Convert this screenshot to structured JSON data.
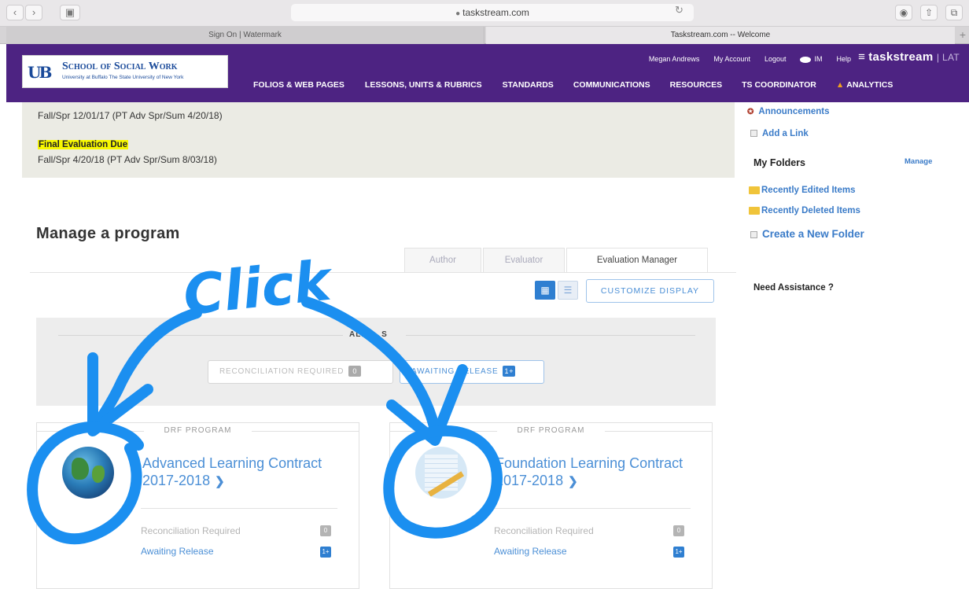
{
  "browser": {
    "address": "taskstream.com",
    "tabs": [
      "Sign On | Watermark",
      "Taskstream.com -- Welcome"
    ]
  },
  "header": {
    "logo_title": "School of Social Work",
    "logo_subtitle": "University at Buffalo The State University of New York",
    "utility": {
      "user": "Megan Andrews",
      "my_account": "My Account",
      "logout": "Logout",
      "im": "IM",
      "help": "Help"
    },
    "brand": "taskstream",
    "brand_suffix": "| LAT",
    "nav": [
      "FOLIOS & WEB PAGES",
      "LESSONS, UNITS & RUBRICS",
      "STANDARDS",
      "COMMUNICATIONS",
      "RESOURCES",
      "TS COORDINATOR",
      "ANALYTICS"
    ]
  },
  "due_dates": {
    "line1": "Fall/Spr 12/01/17 (PT Adv Spr/Sum 4/20/18)",
    "heading2": "Final Evaluation Due",
    "line2": "Fall/Spr 4/20/18 (PT Adv Spr/Sum 8/03/18)"
  },
  "manage": {
    "title": "Manage a program",
    "tabs": [
      "Author",
      "Evaluator",
      "Evaluation Manager"
    ],
    "active_tab": "Evaluation Manager",
    "customize_label": "CUSTOMIZE DISPLAY",
    "filter_label": "ALL ... S",
    "chips": [
      {
        "label": "RECONCILIATION REQUIRED",
        "count": "0"
      },
      {
        "label": "AWAITING RELEASE",
        "count": "1+"
      }
    ]
  },
  "programs": [
    {
      "type": "DRF PROGRAM",
      "title": "Advanced Learning Contract 2017-2018",
      "icon": "globe-icon",
      "stats": [
        {
          "label": "Reconciliation Required",
          "count": "0"
        },
        {
          "label": "Awaiting Release",
          "count": "1+"
        }
      ]
    },
    {
      "type": "DRF PROGRAM",
      "title": "Foundation Learning Contract 2017-2018",
      "icon": "notepad-icon",
      "stats": [
        {
          "label": "Reconciliation Required",
          "count": "0"
        },
        {
          "label": "Awaiting Release",
          "count": "1+"
        }
      ]
    }
  ],
  "sidebar": {
    "announcements": "Announcements",
    "add_link": "Add a Link",
    "my_folders": "My Folders",
    "manage": "Manage",
    "recently_edited": "Recently Edited Items",
    "recently_deleted": "Recently Deleted Items",
    "create_folder": "Create a New Folder",
    "need_assistance": "Need Assistance ?"
  },
  "annotation": {
    "text": "Click",
    "color": "#1b8ff0"
  },
  "colors": {
    "header_purple": "#4d2382",
    "link_blue": "#4b8fd6",
    "highlight_yellow": "#f7f700"
  }
}
